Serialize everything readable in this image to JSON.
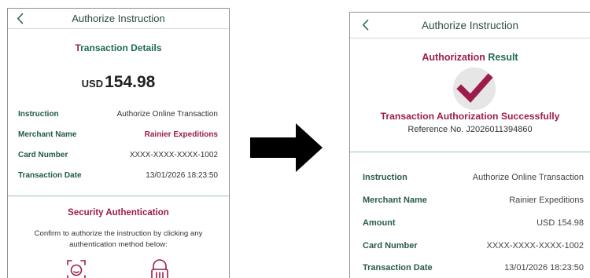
{
  "left_screen": {
    "title": "Authorize Instruction",
    "section_title_first": "T",
    "section_title_rest": "ransaction Details",
    "currency": "USD",
    "amount": "154.98",
    "rows": [
      {
        "label": "Instruction",
        "value": "Authorize Online Transaction"
      },
      {
        "label": "Merchant Name",
        "value": "Rainier Expeditions"
      },
      {
        "label": "Card Number",
        "value": "XXXX-XXXX-XXXX-1002"
      },
      {
        "label": "Transaction Date",
        "value": "13/01/2026 18:23:50"
      }
    ],
    "security_title": "Security Authentication",
    "security_desc": "Confirm to authorize the instruction by clicking any authentication method below:",
    "auth_methods": [
      "face-id-icon",
      "fingerprint-icon"
    ]
  },
  "right_screen": {
    "title": "Authorize Instruction",
    "result_title_first": "Authorization",
    "result_title_rest": " Result",
    "success_message": "Transaction Authorization Successfully",
    "reference_label": "Reference No.",
    "reference_number": "J2026011394860",
    "rows": [
      {
        "label": "Instruction",
        "value": "Authorize Online Transaction"
      },
      {
        "label": "Merchant Name",
        "value": "Rainier Expeditions"
      },
      {
        "label": "Amount",
        "value": "USD 154.98"
      },
      {
        "label": "Card Number",
        "value": "XXXX-XXXX-XXXX-1002"
      },
      {
        "label": "Transaction Date",
        "value": "13/01/2026 18:23:50"
      }
    ]
  },
  "icons": {
    "back": "chevron-left-icon",
    "arrow": "right-arrow-icon",
    "check": "checkmark-icon"
  },
  "colors": {
    "brand_green": "#1f6b55",
    "brand_maroon": "#9c1c4c",
    "divider": "#9fc1b5"
  }
}
